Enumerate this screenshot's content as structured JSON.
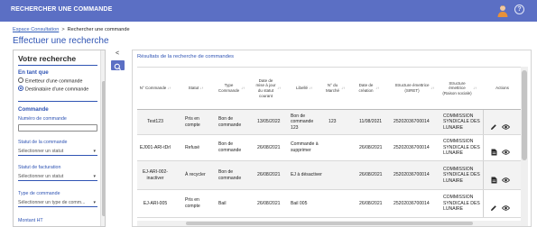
{
  "header": {
    "title": "RECHERCHER UNE COMMANDE",
    "brand_color": "#5b6fc4",
    "user_icon": "user-avatar-icon",
    "help_icon": "help-circle-icon",
    "help_glyph": "?"
  },
  "breadcrumb": {
    "link": "Espace Consultation",
    "separator": ">",
    "current": "Rechercher une commande"
  },
  "page_title": "Effectuer une recherche",
  "sidebar": {
    "title": "Votre recherche",
    "en_tant_que": {
      "label": "En tant que",
      "options": [
        {
          "label": "Emetteur d'une commande",
          "checked": false
        },
        {
          "label": "Destinataire d'une commande",
          "checked": true
        }
      ]
    },
    "commande": {
      "label": "Commande",
      "numero_label": "Numéro de commande",
      "numero_value": "",
      "statut_label": "Statut de la commande",
      "statut_placeholder": "Sélectionner un statut",
      "facturation_label": "Statut de facturation",
      "facturation_placeholder": "Sélectionner un statut",
      "type_label": "Type de commande",
      "type_placeholder": "Sélectionner un type de comm...",
      "montant_label": "Montant HT"
    }
  },
  "controls": {
    "collapse_glyph": "<",
    "collapse_icon": "chevron-left-icon",
    "search_icon": "search-icon"
  },
  "results": {
    "title": "Résultats de la recherche de commandes",
    "columns": [
      "N° Commande",
      "Statut",
      "Type Commande",
      "Date de mise à jour du statut courant",
      "Libellé",
      "N° du Marché",
      "Date de création",
      "Structure émettrice (SIRET)",
      "Structure émettrice (Raison sociale)",
      "Actions"
    ],
    "sort_glyph": "↓↑",
    "rows": [
      {
        "numero": "Test123",
        "statut": "Pris en compte",
        "type": "Bon de commande",
        "date_maj": "13/05/2022",
        "libelle": "Bon de commande 123",
        "marche": "123",
        "date_creation": "11/08/2021",
        "siret": "25202036700014",
        "raison": "COMMISSION SYNDICALE DES LUNAIRE",
        "actions": [
          "edit-icon",
          "view-eye-icon"
        ]
      },
      {
        "numero": "EJ001-ARI-tDrl",
        "statut": "Refusé",
        "type": "Bon de commande",
        "date_maj": "26/08/2021",
        "libelle": "Commande à supprimer",
        "marche": "",
        "date_creation": "26/08/2021",
        "siret": "25202036700014",
        "raison": "COMMISSION SYNDICALE DES LUNAIRE",
        "actions": [
          "document-icon",
          "view-eye-icon"
        ]
      },
      {
        "numero": "EJ-ARI-002-inactiver",
        "statut": "À recycler",
        "type": "Bon de commande",
        "date_maj": "26/08/2021",
        "libelle": "EJ à désactiver",
        "marche": "",
        "date_creation": "26/08/2021",
        "siret": "25202036700014",
        "raison": "COMMISSION SYNDICALE DES LUNAIRE",
        "actions": [
          "document-icon",
          "view-eye-icon"
        ]
      },
      {
        "numero": "EJ-ARI-005",
        "statut": "Pris en compte",
        "type": "Bail",
        "date_maj": "26/08/2021",
        "libelle": "Bail 005",
        "marche": "",
        "date_creation": "26/08/2021",
        "siret": "25202036700014",
        "raison": "COMMISSION SYNDICALE DES LUNAIRE",
        "actions": [
          "edit-icon",
          "view-eye-icon"
        ]
      }
    ]
  }
}
